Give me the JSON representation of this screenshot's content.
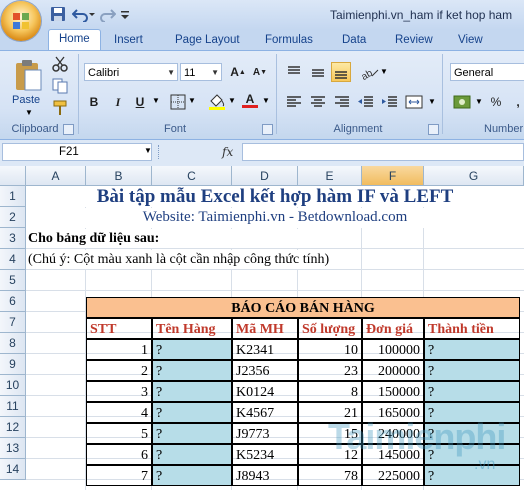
{
  "window": {
    "title": "Taimienphi.vn_ham if ket hop ham"
  },
  "tabs": [
    "Home",
    "Insert",
    "Page Layout",
    "Formulas",
    "Data",
    "Review",
    "View"
  ],
  "ribbon": {
    "clipboard": {
      "paste_label": "Paste",
      "group_label": "Clipboard"
    },
    "font": {
      "font_name": "Calibri",
      "font_size": "11",
      "group_label": "Font",
      "bold": "B",
      "italic": "I",
      "underline": "U"
    },
    "alignment": {
      "group_label": "Alignment"
    },
    "number": {
      "format": "General",
      "group_label": "Number",
      "percent": "%"
    }
  },
  "formula_bar": {
    "name_box": "F21",
    "fx": "fx",
    "value": ""
  },
  "columns": [
    "A",
    "B",
    "C",
    "D",
    "E",
    "F",
    "G"
  ],
  "rows": [
    "1",
    "2",
    "3",
    "4",
    "5",
    "6",
    "7",
    "8",
    "9",
    "10",
    "11",
    "12",
    "13",
    "14"
  ],
  "sheet": {
    "title": "Bài tập mẫu Excel kết hợp hàm IF và LEFT",
    "website": "Website: Taimienphi.vn - Betdownload.com",
    "prompt": "Cho bảng dữ liệu sau:",
    "note": "(Chú ý: Cột màu xanh là cột cần nhập công thức tính)",
    "report_title": "BÁO CÁO BÁN HÀNG",
    "headers": [
      "STT",
      "Tên Hàng",
      "Mã MH",
      "Số lượng",
      "Đơn giá",
      "Thành tiền"
    ],
    "data": [
      {
        "stt": "1",
        "ten": "?",
        "ma": "K2341",
        "sl": "10",
        "gia": "100000",
        "tien": "?"
      },
      {
        "stt": "2",
        "ten": "?",
        "ma": "J2356",
        "sl": "23",
        "gia": "200000",
        "tien": "?"
      },
      {
        "stt": "3",
        "ten": "?",
        "ma": "K0124",
        "sl": "8",
        "gia": "150000",
        "tien": "?"
      },
      {
        "stt": "4",
        "ten": "?",
        "ma": "K4567",
        "sl": "21",
        "gia": "165000",
        "tien": "?"
      },
      {
        "stt": "5",
        "ten": "?",
        "ma": "J9773",
        "sl": "15",
        "gia": "240000",
        "tien": "?"
      },
      {
        "stt": "6",
        "ten": "?",
        "ma": "K5234",
        "sl": "12",
        "gia": "145000",
        "tien": "?"
      },
      {
        "stt": "7",
        "ten": "?",
        "ma": "J8943",
        "sl": "78",
        "gia": "225000",
        "tien": "?"
      }
    ]
  },
  "watermark": {
    "text": "Taimienphi",
    "suffix": ".vn"
  },
  "colors": {
    "title_blue": "#1f3f80",
    "header_red": "#c0392b",
    "input_blue": "#b7dde8",
    "title_orange": "#fac090"
  }
}
